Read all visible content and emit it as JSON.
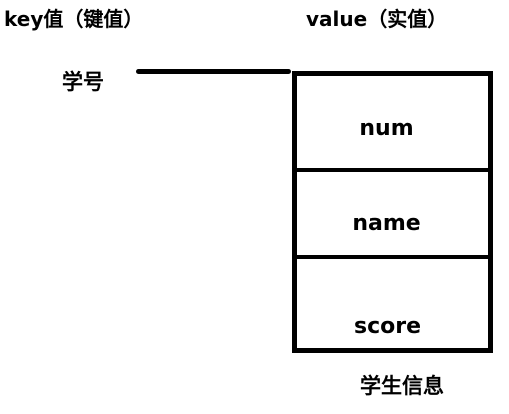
{
  "headers": {
    "key": "key值（键值）",
    "value": "value（实值）"
  },
  "key_label": "学号",
  "record": {
    "fields": [
      "num",
      "name",
      "score"
    ]
  },
  "caption": "学生信息"
}
